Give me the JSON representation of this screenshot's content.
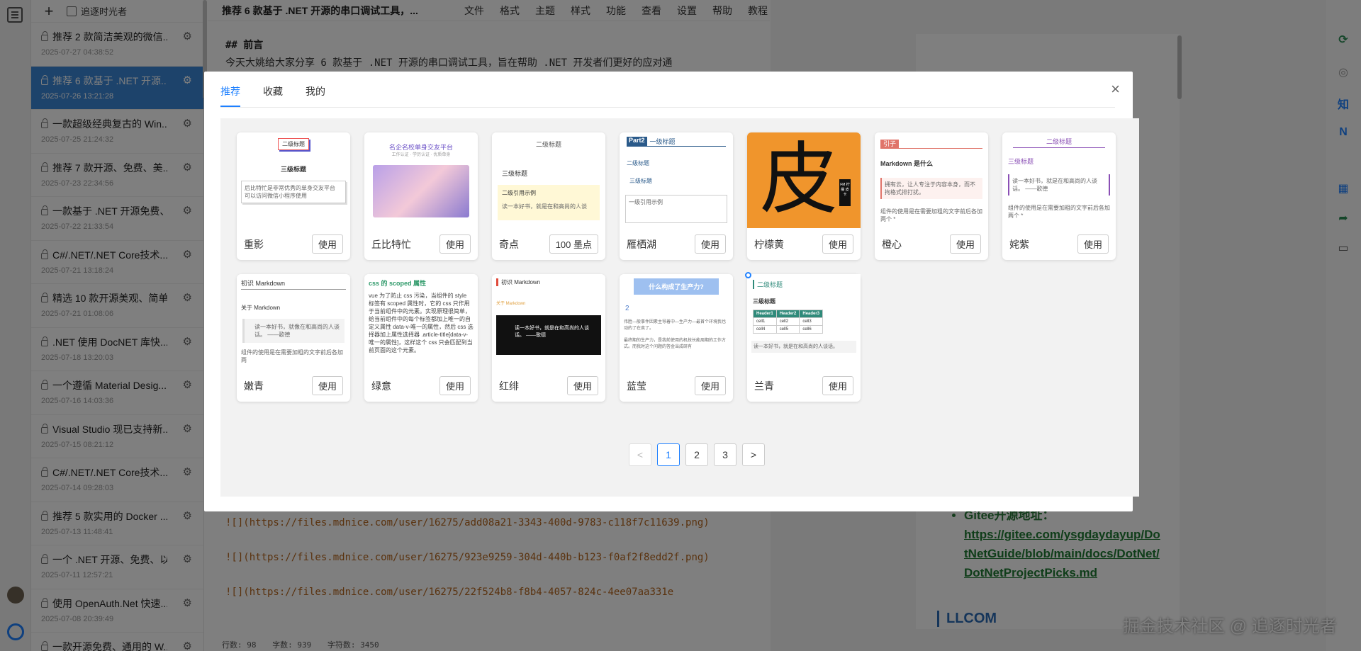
{
  "list": {
    "user": "追逐时光者",
    "items": [
      {
        "title": "推荐 2 款简洁美观的微信...",
        "date": "2025-07-27 04:38:52"
      },
      {
        "title": "推荐 6 款基于 .NET 开源...",
        "date": "2025-07-26 13:21:28"
      },
      {
        "title": "一款超级经典复古的 Win...",
        "date": "2025-07-25 21:24:32"
      },
      {
        "title": "推荐 7 款开源、免费、美...",
        "date": "2025-07-23 22:34:56"
      },
      {
        "title": "一款基于 .NET 开源免费、...",
        "date": "2025-07-22 21:33:54"
      },
      {
        "title": "C#/.NET/.NET Core技术...",
        "date": "2025-07-21 13:18:24"
      },
      {
        "title": "精选 10 款开源美观、简单...",
        "date": "2025-07-21 01:08:06"
      },
      {
        "title": ".NET 使用 DocNET 库快...",
        "date": "2025-07-18 13:20:03"
      },
      {
        "title": "一个遵循 Material Desig...",
        "date": "2025-07-16 14:03:36"
      },
      {
        "title": "Visual Studio 现已支持新...",
        "date": "2025-07-15 08:21:12"
      },
      {
        "title": "C#/.NET/.NET Core技术...",
        "date": "2025-07-14 09:28:03"
      },
      {
        "title": "推荐 5 款实用的 Docker ...",
        "date": "2025-07-13 11:48:41"
      },
      {
        "title": "一个 .NET 开源、免费、以...",
        "date": "2025-07-11 12:57:21"
      },
      {
        "title": "使用 OpenAuth.Net 快速...",
        "date": "2025-07-08 20:39:49"
      },
      {
        "title": "一款开源免费、通用的 W...",
        "date": ""
      }
    ]
  },
  "editor": {
    "title": "推荐 6 款基于 .NET 开源的串口调试工具，...",
    "menu": [
      "文件",
      "格式",
      "主题",
      "样式",
      "功能",
      "查看",
      "设置",
      "帮助",
      "教程"
    ],
    "heading": "## 前言",
    "intro": "今天大姚给大家分享 6 款基于 .NET 开源的串口调试工具，旨在帮助 .NET 开发者们更好的应对通",
    "links": [
      "![](https://files.mdnice.com/user/16275/add08a21-3343-400d-9783-c118f7c11639.png)",
      "![](https://files.mdnice.com/user/16275/923e9259-304d-440b-b123-f0af2f8edd2f.png)",
      "![](https://files.mdnice.com/user/16275/22f524b8-f8b4-4057-824c-4ee07aa331e"
    ],
    "status": {
      "lines": "行数: 98",
      "words": "字数: 939",
      "chars": "字符数: 3450"
    }
  },
  "preview": {
    "gitee_label": "Gitee开源地址：",
    "gitee_url": "https://gitee.com/ysgdaydayup/DotNetGuide/blob/main/docs/DotNet/DotNetProjectPicks.md",
    "bottom_heading": "LLCOM"
  },
  "watermark": "掘金技术社区 @ 追逐时光者",
  "dialog": {
    "tabs": [
      "推荐",
      "收藏",
      "我的"
    ],
    "close": "×",
    "themes": [
      {
        "name": "重影",
        "action": "使用"
      },
      {
        "name": "丘比特忙",
        "action": "使用"
      },
      {
        "name": "奇点",
        "action": "100 墨点"
      },
      {
        "name": "雁栖湖",
        "action": "使用"
      },
      {
        "name": "柠檬黄",
        "action": "使用"
      },
      {
        "name": "橙心",
        "action": "使用"
      },
      {
        "name": "姹紫",
        "action": "使用"
      },
      {
        "name": "嫩青",
        "action": "使用"
      },
      {
        "name": "绿意",
        "action": "使用"
      },
      {
        "name": "红绯",
        "action": "使用"
      },
      {
        "name": "蓝莹",
        "action": "使用"
      },
      {
        "name": "兰青",
        "action": "使用"
      }
    ],
    "thumb_text": {
      "t1_h2": "二级标题",
      "t1_h3": "三级标题",
      "t1_q": "后比特忙是非常优秀的单身交友平台",
      "t1_q2": "可以访问微信小程序使用",
      "t2_title": "名企名校单身交友平台",
      "t2_sub": "工作认证 · 学历认证 · 优质单身",
      "t3_h2": "二级标题",
      "t3_h3": "三级标题",
      "t3_q": "二级引用示例",
      "t3_q2": "读一本好书，就是在和高尚的人谈",
      "t4_part": "Part2",
      "t4_h2": "一级标题",
      "t4_h3a": "二级标题",
      "t4_h3b": "三级标题",
      "t4_q": "一级引用示例",
      "t5_char": "皮",
      "t5_tag": "FM 柠檬 皮卡",
      "t6_tag": "引子",
      "t6_h": "Markdown 是什么",
      "t6_q": "拥有云，让人专注于内容本身，而不拘格式排打扰。",
      "t6_p": "组件的使用是在需要加粗的文字前后各加两个 *",
      "t7_h2": "二级标题",
      "t7_h3": "三级标题",
      "t7_q": "读一本好书，就是在和高尚的人谈话。 ——歌德",
      "t7_p": "组件的使用是在需要加粗的文字前后各加两个 *",
      "t8_h": "初识 Markdown",
      "t8_sub": "关于 Markdown",
      "t8_q": "读一本好书，就像在和高尚的人谈话。 ——歌德",
      "t8_p": "组件的使用是在需要加粗的文字前后各加两",
      "t9_h": "css 的 scoped 属性",
      "t9_p": "vue 为了防止 css 污染，当组件的 style 标签有 scoped 属性时，它的 css 只作用于当前组件中的元素。实现原理很简单，给当前组件中的每个标签都加上唯一的自定义属性 data-v-唯一的属性，然后 css 选择器加上属性选择器 .article-title[data-v-唯一的属性]，这样这个 css 只会匹配到当前页面的这个元素。",
      "t10_h": "初识 Markdown",
      "t10_sub": "关于 Markdown",
      "t10_q": "读一本好书，就是在和高尚的人谈话。 ——歌德",
      "t11_h": "什么构成了生产力?",
      "t11_num": "2",
      "t11_p1": "伟胜—般事件因素主导着中—生产力—最首个环境我也动的了在卖了。",
      "t11_p2": "最终期的生产力，是我前使用的机技长能周期的工作方式。而我时这个问题的答金当成研有",
      "t12_h2": "二级标题",
      "t12_h3": "三级标题",
      "t12_table": [
        [
          "Header1",
          "Header2",
          "Header3"
        ],
        [
          "cell1",
          "cell2",
          "cell3"
        ],
        [
          "cell4",
          "cell5",
          "cell6"
        ]
      ],
      "t12_q": "读一本好书，就是在和高尚的人谈话。"
    },
    "pager": {
      "prev": "<",
      "pages": [
        "1",
        "2",
        "3"
      ],
      "next": ">",
      "current": "1"
    }
  },
  "colors": {
    "accent": "#1e80ff",
    "active_item": "#3b86d6",
    "lemon": "#f0952c"
  }
}
